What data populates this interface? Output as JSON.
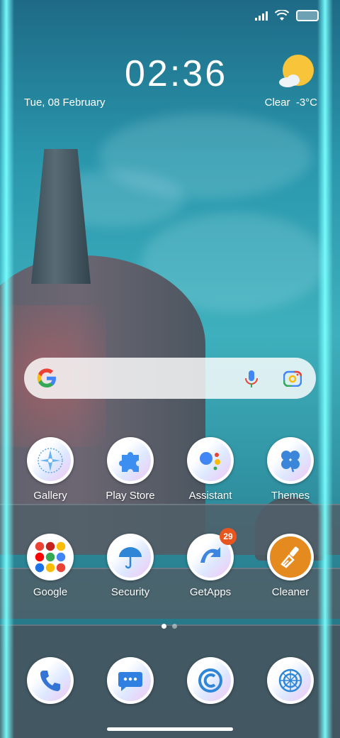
{
  "status": {
    "icons": [
      "signal-icon",
      "wifi-icon",
      "battery-icon"
    ]
  },
  "clock": {
    "time": "02:36",
    "date": "Tue, 08 February"
  },
  "weather": {
    "condition": "Clear",
    "temp": "-3°C",
    "icon": "sun-cloud-icon"
  },
  "search": {
    "icons": [
      "google-g-icon",
      "mic-icon",
      "lens-icon"
    ]
  },
  "apps_row1": [
    {
      "label": "Gallery",
      "icon": "gallery-icon"
    },
    {
      "label": "Play Store",
      "icon": "puzzle-icon"
    },
    {
      "label": "Assistant",
      "icon": "assistant-icon"
    },
    {
      "label": "Themes",
      "icon": "clover-icon"
    }
  ],
  "apps_row2": [
    {
      "label": "Google",
      "icon": "google-folder-icon"
    },
    {
      "label": "Security",
      "icon": "umbrella-icon"
    },
    {
      "label": "GetApps",
      "icon": "getapps-icon",
      "badge": "29"
    },
    {
      "label": "Cleaner",
      "icon": "brush-icon"
    }
  ],
  "dock": [
    {
      "icon": "phone-icon"
    },
    {
      "icon": "messages-icon"
    },
    {
      "icon": "browser-icon"
    },
    {
      "icon": "camera-icon"
    }
  ],
  "pager": {
    "pages": 2,
    "current": 1
  },
  "colors": {
    "badge": "#e8561f",
    "cleaner": "#e58a1e",
    "sun": "#f7c43a"
  }
}
